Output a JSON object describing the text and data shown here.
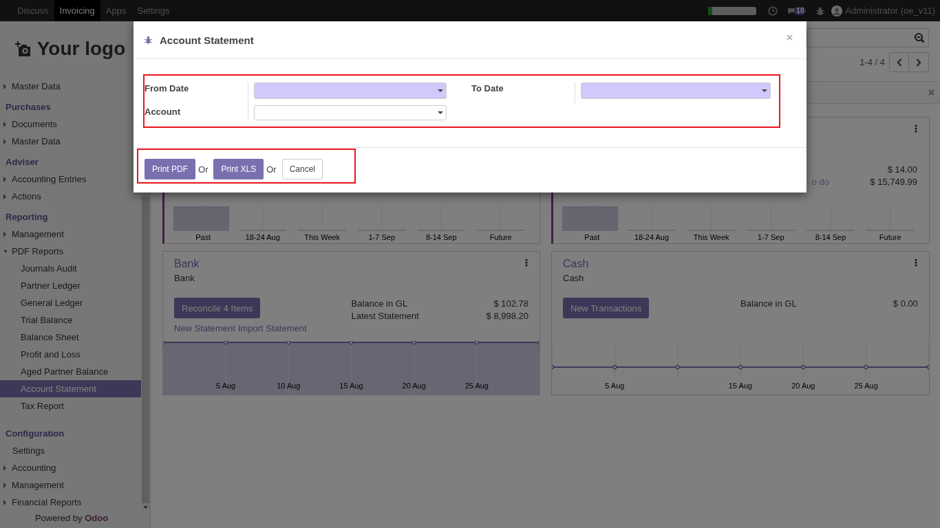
{
  "navbar": {
    "apps": [
      {
        "label": "Discuss",
        "selected": false
      },
      {
        "label": "Invoicing",
        "selected": true
      },
      {
        "label": "Apps",
        "selected": false
      },
      {
        "label": "Settings",
        "selected": false
      }
    ],
    "progress": {
      "level": 0.08
    },
    "chat_badge": "10",
    "user": "Administrator (oe_v11)"
  },
  "sidebar": {
    "logo": "Your logo",
    "sections": [
      {
        "items": [
          {
            "label": "Master Data",
            "expanded": false
          }
        ]
      },
      {
        "title": "Purchases",
        "items": [
          {
            "label": "Documents",
            "expanded": false
          },
          {
            "label": "Master Data",
            "expanded": false
          }
        ]
      },
      {
        "title": "Adviser",
        "items": [
          {
            "label": "Accounting Entries",
            "expanded": false
          },
          {
            "label": "Actions",
            "expanded": false
          }
        ]
      },
      {
        "title": "Reporting",
        "items": [
          {
            "label": "Management",
            "expanded": false
          },
          {
            "label": "PDF Reports",
            "expanded": true,
            "children": [
              {
                "label": "Journals Audit",
                "selected": false
              },
              {
                "label": "Partner Ledger",
                "selected": false
              },
              {
                "label": "General Ledger",
                "selected": false
              },
              {
                "label": "Trial Balance",
                "selected": false
              },
              {
                "label": "Balance Sheet",
                "selected": false
              },
              {
                "label": "Profit and Loss",
                "selected": false
              },
              {
                "label": "Aged Partner Balance",
                "selected": false
              },
              {
                "label": "Account Statement",
                "selected": true
              },
              {
                "label": "Tax Report",
                "selected": false
              }
            ]
          }
        ]
      },
      {
        "title": "Configuration",
        "items": [
          {
            "label": "Settings"
          },
          {
            "label": "Accounting",
            "expanded": false
          },
          {
            "label": "Management",
            "expanded": false
          },
          {
            "label": "Financial Reports",
            "expanded": false
          }
        ]
      }
    ],
    "footer": {
      "text": "Powered by",
      "brand": "Odoo"
    }
  },
  "control_panel": {
    "pager": "1-4 / 4"
  },
  "kanban": {
    "cards": [
      {
        "kind": "activity",
        "chart": {
          "kind": "bars",
          "categories": [
            {
              "label": "Past",
              "kind": "filled"
            },
            {
              "label": "18-24 Aug",
              "kind": "empty"
            },
            {
              "label": "This Week",
              "kind": "empty"
            },
            {
              "label": "1-7 Sep",
              "kind": "empty"
            },
            {
              "label": "8-14 Sep",
              "kind": "empty"
            },
            {
              "label": "Future",
              "kind": "empty"
            }
          ]
        }
      },
      {
        "kind": "activity",
        "menu": true,
        "rows": [
          {
            "amount": "$ 14.00"
          },
          {
            "label": "o do",
            "amount": "$ 15,749.99"
          }
        ],
        "chart": {
          "kind": "bars",
          "categories": [
            {
              "label": "Past",
              "kind": "filled"
            },
            {
              "label": "18-24 Aug",
              "kind": "empty"
            },
            {
              "label": "This Week",
              "kind": "empty"
            },
            {
              "label": "1-7 Sep",
              "kind": "empty"
            },
            {
              "label": "8-14 Sep",
              "kind": "empty"
            },
            {
              "label": "Future",
              "kind": "empty"
            }
          ]
        }
      },
      {
        "kind": "journal",
        "title": "Bank",
        "subtitle": "Bank",
        "menu": true,
        "button": "Reconcile 4 Items",
        "links": [
          "New Statement",
          "Import Statement"
        ],
        "rows": [
          {
            "label": "Balance in GL",
            "amount": "$ 102.78"
          },
          {
            "label": "Latest Statement",
            "amount": "$ 8,998.20"
          }
        ],
        "chart": {
          "kind": "area",
          "points": [
            {
              "kind": "point"
            },
            {
              "kind": "labeled",
              "label": "5 Aug"
            },
            {
              "kind": "labeled",
              "label": "10 Aug"
            },
            {
              "kind": "labeled",
              "label": "15 Aug"
            },
            {
              "kind": "labeled",
              "label": "20 Aug"
            },
            {
              "kind": "labeled",
              "label": "25 Aug"
            },
            {
              "kind": "point"
            }
          ]
        }
      },
      {
        "kind": "journal",
        "title": "Cash",
        "subtitle": "Cash",
        "menu": true,
        "button": "New Transactions",
        "rows": [
          {
            "label": "Balance in GL",
            "amount": "$ 0.00"
          }
        ],
        "chart": {
          "kind": "line",
          "points": [
            {
              "kind": "point"
            },
            {
              "kind": "labeled",
              "label": "5 Aug"
            },
            {
              "kind": "point"
            },
            {
              "kind": "labeled",
              "label": "15 Aug"
            },
            {
              "kind": "labeled",
              "label": "20 Aug"
            },
            {
              "kind": "labeled",
              "label": "25 Aug"
            },
            {
              "kind": "point"
            }
          ]
        }
      }
    ]
  },
  "dialog": {
    "title": "Account Statement",
    "form": {
      "highlighted": true,
      "groups": [
        {
          "fields": [
            {
              "label": "From Date",
              "required": true
            },
            {
              "label": "Account",
              "required": false
            }
          ]
        },
        {
          "fields": [
            {
              "label": "To Date",
              "required": true
            }
          ]
        }
      ]
    },
    "footer": {
      "highlighted": true,
      "actions": [
        {
          "kind": "primary",
          "label": "Print PDF"
        },
        {
          "kind": "text",
          "label": "Or"
        },
        {
          "kind": "primary",
          "label": "Print XLS"
        },
        {
          "kind": "text",
          "label": "Or"
        },
        {
          "kind": "secondary",
          "label": "Cancel"
        }
      ]
    }
  }
}
